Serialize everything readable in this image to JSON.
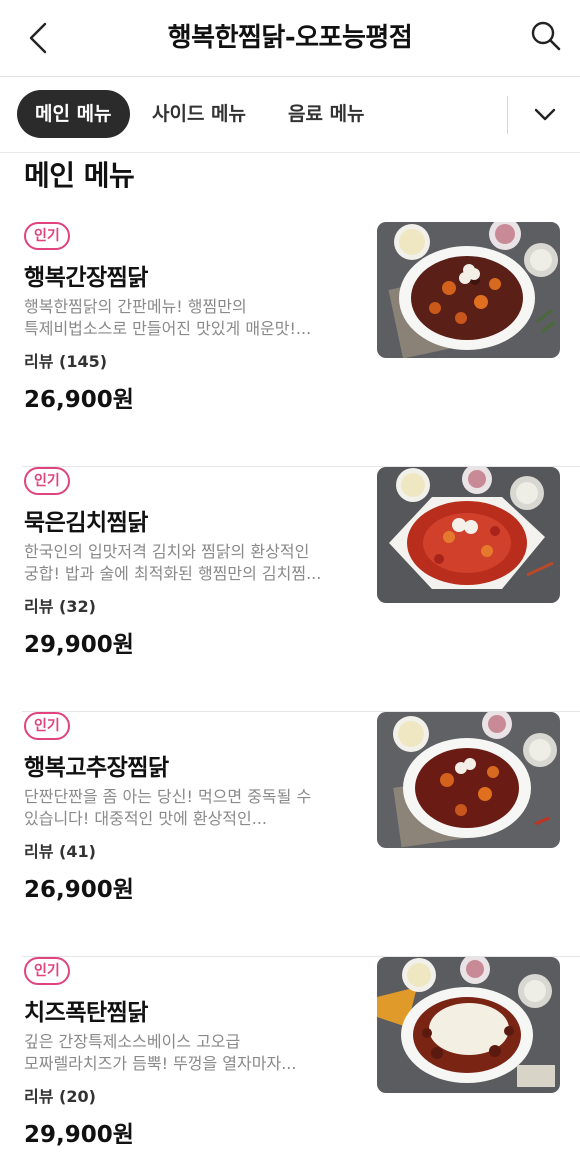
{
  "header": {
    "title": "행복한찜닭-오포능평점",
    "back_icon": "chevron-left-icon",
    "search_icon": "search-icon"
  },
  "tabs": {
    "items": [
      {
        "label": "메인 메뉴",
        "active": true
      },
      {
        "label": "사이드 메뉴",
        "active": false
      },
      {
        "label": "음료 메뉴",
        "active": false
      }
    ],
    "expand_icon": "chevron-down-icon"
  },
  "section": {
    "title": "메인 메뉴"
  },
  "colors": {
    "accent": "#e0437e",
    "active_tab": "#2b2b2b",
    "desc_text": "#8a8a8a"
  },
  "menu": [
    {
      "badge": "인기",
      "name": "행복간장찜닭",
      "desc_line1": "행복한찜닭의 간판메뉴! 행찜만의",
      "desc_line2": "특제비법소스로 만들어진 맛있게 매운맛!...",
      "review": "리뷰 (145)",
      "price": "26,900원"
    },
    {
      "badge": "인기",
      "name": "묵은김치찜닭",
      "desc_line1": "한국인의 입맛저격 김치와 찜닭의 환상적인",
      "desc_line2": "궁합! 밥과 술에 최적화된 행찜만의 김치찜...",
      "review": "리뷰 (32)",
      "price": "29,900원"
    },
    {
      "badge": "인기",
      "name": "행복고추장찜닭",
      "desc_line1": "단짠단짠을 좀 아는 당신! 먹으면 중독될 수",
      "desc_line2": "있습니다! 대중적인 맛에 환상적인...",
      "review": "리뷰 (41)",
      "price": "26,900원"
    },
    {
      "badge": "인기",
      "name": "치즈폭탄찜닭",
      "desc_line1": "깊은 간장특제소스베이스 고오급",
      "desc_line2": "모짜렐라치즈가 듬뿍! 뚜껑을 열자마자...",
      "review": "리뷰 (20)",
      "price": "29,900원"
    }
  ]
}
